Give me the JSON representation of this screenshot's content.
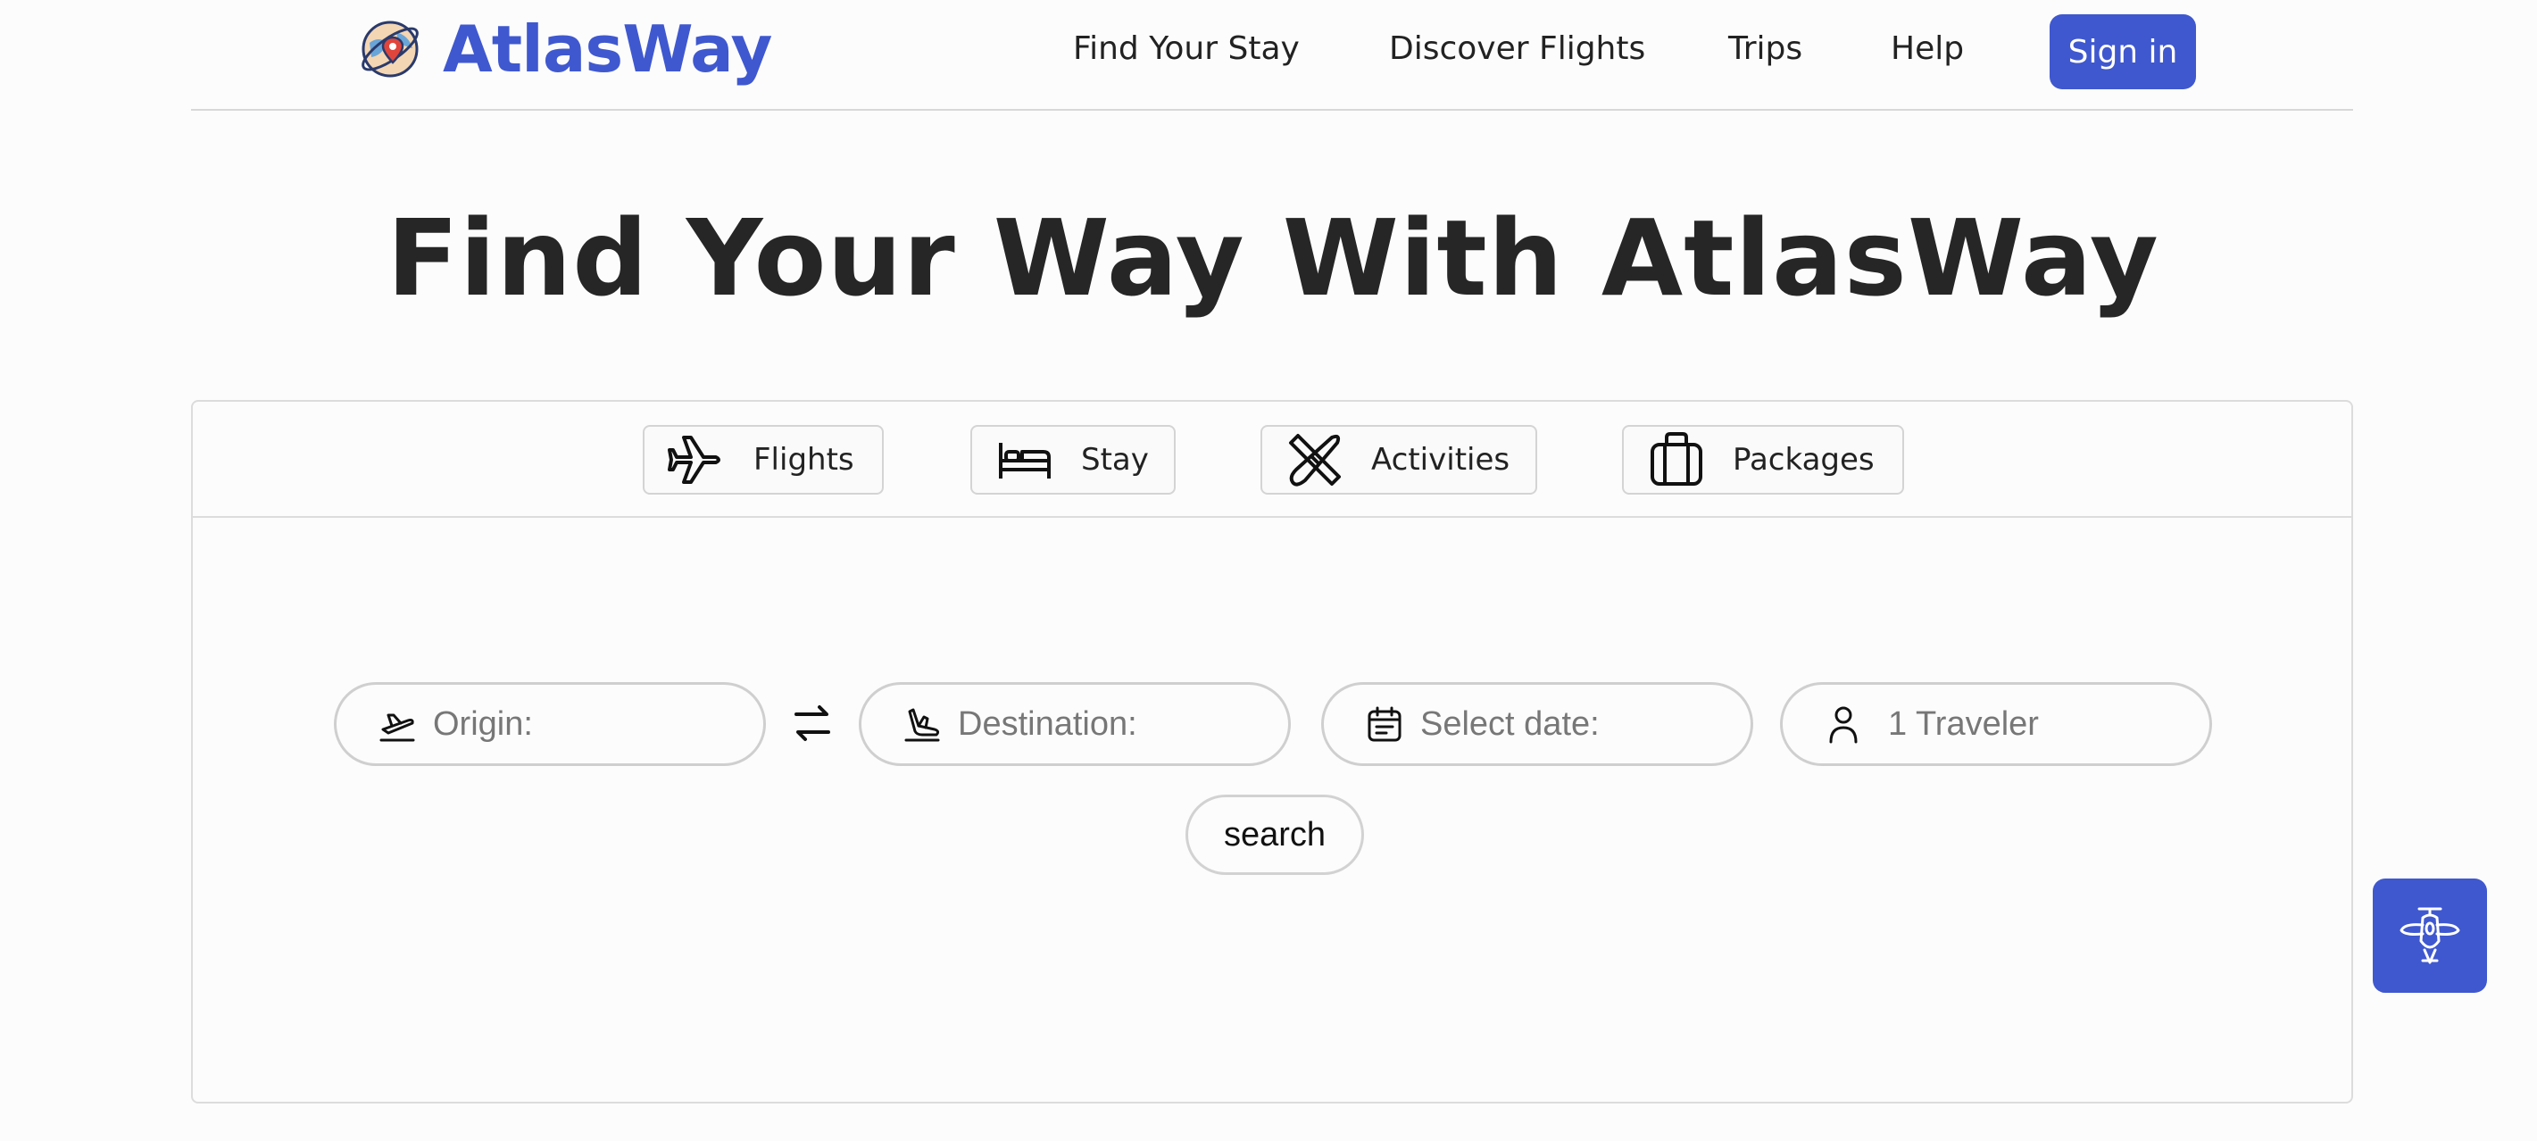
{
  "brand": {
    "name": "AtlasWay",
    "logo_icon": "globe-pin-icon",
    "accent_color": "#3f58cf"
  },
  "nav": {
    "items": [
      {
        "label": "Find Your Stay"
      },
      {
        "label": "Discover Flights"
      },
      {
        "label": "Trips"
      },
      {
        "label": "Help"
      }
    ],
    "signin_label": "Sign in"
  },
  "hero": {
    "title": "Find Your Way With AtlasWay"
  },
  "search": {
    "tabs": [
      {
        "label": "Flights",
        "icon": "airplane-icon"
      },
      {
        "label": "Stay",
        "icon": "bed-icon"
      },
      {
        "label": "Activities",
        "icon": "kayak-icon"
      },
      {
        "label": "Packages",
        "icon": "luggage-icon"
      }
    ],
    "fields": {
      "origin": {
        "placeholder": "Origin:",
        "icon": "takeoff-icon"
      },
      "destination": {
        "placeholder": "Destination:",
        "icon": "landing-icon"
      },
      "date": {
        "placeholder": "Select date:",
        "icon": "calendar-icon"
      },
      "travelers": {
        "placeholder": "1 Traveler",
        "icon": "person-icon"
      }
    },
    "swap_icon": "swap-arrows-icon",
    "button_label": "search"
  },
  "fab": {
    "icon": "airplane-assistant-icon"
  }
}
